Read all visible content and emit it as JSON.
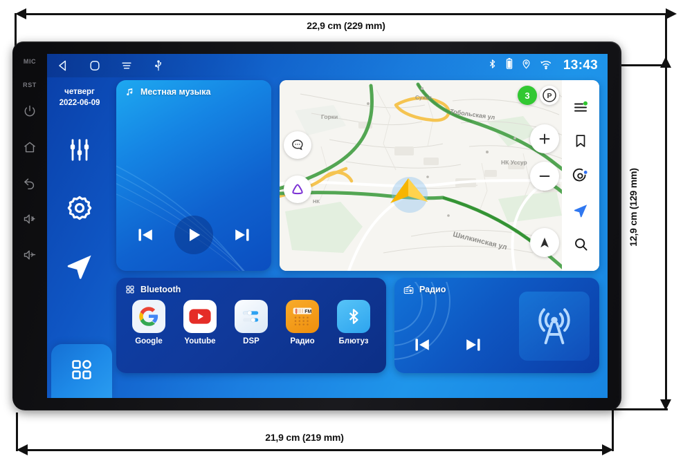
{
  "dimensions": {
    "top": "22,9 cm (229 mm)",
    "bottom": "21,9 cm (219 mm)",
    "right": "12,9 cm (129 mm)"
  },
  "bezel": {
    "keys": [
      {
        "label": "MIC",
        "name": "mic-label",
        "type": "text"
      },
      {
        "label": "RST",
        "name": "rst-label",
        "type": "text"
      },
      {
        "label": "power",
        "name": "power-icon",
        "type": "icon"
      },
      {
        "label": "home",
        "name": "home-icon",
        "type": "icon"
      },
      {
        "label": "back",
        "name": "back-icon",
        "type": "icon"
      },
      {
        "label": "volume-up",
        "name": "volume-up-icon",
        "type": "icon"
      },
      {
        "label": "volume-down",
        "name": "volume-down-icon",
        "type": "icon"
      }
    ]
  },
  "statusbar": {
    "nav_icons": [
      "back-triangle-icon",
      "home-square-icon",
      "recents-menu-icon",
      "usb-icon"
    ],
    "right_icons": [
      "bluetooth-icon",
      "battery-icon",
      "location-pin-icon",
      "wifi-icon"
    ],
    "time": "13:43"
  },
  "rail": {
    "day_of_week": "четверг",
    "date": "2022-06-09",
    "icons": [
      "equalizer-icon",
      "settings-gear-icon",
      "navigation-arrow-icon"
    ],
    "apps_button": "apps-grid-icon"
  },
  "music_card": {
    "title": "Местная музыка",
    "icon": "music-note-icon",
    "controls": [
      "previous-track-icon",
      "play-icon",
      "next-track-icon"
    ]
  },
  "map_card": {
    "streets": [
      "Тобольская ул",
      "Шилкинская ул"
    ],
    "poi_labels": [
      "НК Уссур",
      "НК",
      "Сухая"
    ],
    "traffic_score": "3",
    "parking_badge": "P",
    "toolbar_icons": [
      "menu-layers-icon",
      "bookmark-icon",
      "alice-assistant-icon",
      "navigator-arrow-icon",
      "search-icon"
    ],
    "left_fabs": [
      "chat-bubble-icon",
      "navigator-logo-icon"
    ],
    "zoom_in": "+",
    "zoom_out": "−",
    "compass": "compass-arrow-icon"
  },
  "apps_card": {
    "title": "Bluetooth",
    "icon": "apps-grid-small-icon",
    "apps": [
      {
        "label": "Google",
        "icon": "google-icon",
        "bg": "#eef4fb"
      },
      {
        "label": "Youtube",
        "icon": "youtube-icon",
        "bg": "#ffffff"
      },
      {
        "label": "DSP",
        "icon": "dsp-icon",
        "bg": "#eef5fc"
      },
      {
        "label": "Радио",
        "icon": "fm-radio-icon",
        "bg": "#f49b1c"
      },
      {
        "label": "Блютуз",
        "icon": "bluetooth-app-icon",
        "bg": "#3fb6f5"
      }
    ]
  },
  "radio_card": {
    "title": "Радио",
    "icon": "radio-set-icon",
    "controls": [
      "previous-station-icon",
      "next-station-icon"
    ],
    "artwork": "radio-tower-icon"
  },
  "colors": {
    "screen_blue_dark": "#0a3fa8",
    "screen_blue_light": "#1f95ea",
    "bezel_black": "#131316",
    "accent_white": "#ffffff",
    "traffic_green": "#32c832",
    "radio_orange": "#f49b1c",
    "youtube_red": "#e52d27",
    "bluetooth_blue": "#3fb6f5"
  }
}
